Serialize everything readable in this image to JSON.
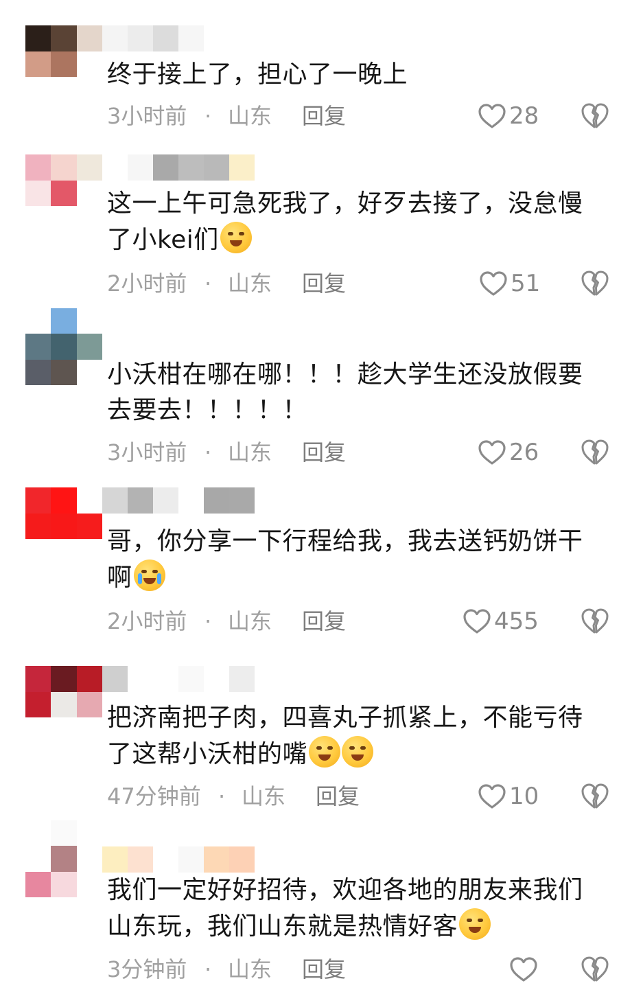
{
  "comments": [
    {
      "text": "终于接上了，担心了一晚上",
      "time": "3小时前",
      "separator": "·",
      "location": "山东",
      "reply": "回复",
      "likes": "28"
    },
    {
      "text": "这一上午可急死我了，好歹去接了，没怠慢了小kei们",
      "time": "2小时前",
      "separator": "·",
      "location": "山东",
      "reply": "回复",
      "likes": "51"
    },
    {
      "text": "小沃柑在哪在哪！！！趁大学生还没放假要去要去！！！！！",
      "time": "3小时前",
      "separator": "·",
      "location": "山东",
      "reply": "回复",
      "likes": "26"
    },
    {
      "text": "哥，你分享一下行程给我，我去送钙奶饼干啊",
      "time": "2小时前",
      "separator": "·",
      "location": "山东",
      "reply": "回复",
      "likes": "455"
    },
    {
      "text": "把济南把子肉，四喜丸子抓紧上，不能亏待了这帮小沃柑的嘴",
      "time": "47分钟前",
      "separator": "·",
      "location": "山东",
      "reply": "回复",
      "likes": "10"
    },
    {
      "text": "我们一定好好招待，欢迎各地的朋友来我们山东玩，我们山东就是热情好客",
      "time": "3分钟前",
      "separator": "·",
      "location": "山东",
      "reply": "回复",
      "likes": ""
    }
  ],
  "icons": {
    "like": "heart-outline-icon",
    "dislike": "broken-heart-icon"
  },
  "colors": {
    "text": "#161616",
    "meta": "#a0a0a0",
    "icon": "#8a8a8a"
  }
}
